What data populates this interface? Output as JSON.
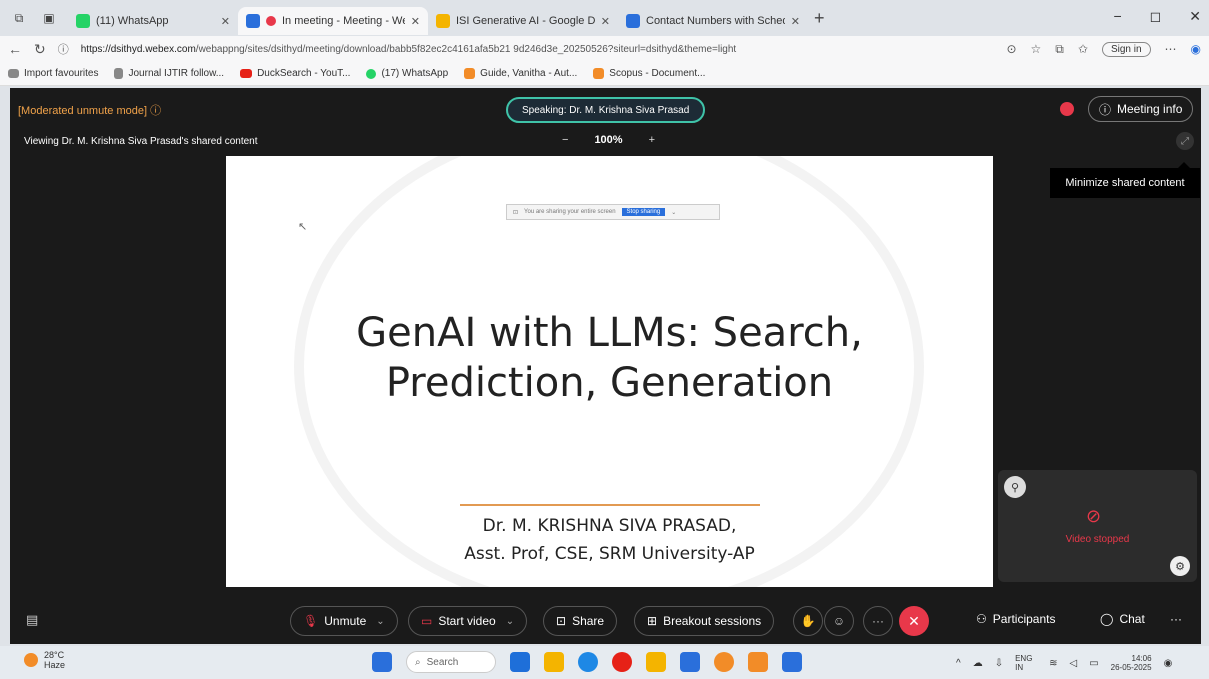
{
  "browser": {
    "tabs": [
      {
        "title": "(11) WhatsApp",
        "favicon_color": "#25d366",
        "active": false
      },
      {
        "title": "In meeting - Meeting - Web...",
        "favicon_color": "#2a6fdb",
        "active": true
      },
      {
        "title": "ISI Generative AI - Google Drive",
        "favicon_color": "#f4b400",
        "active": false
      },
      {
        "title": "Contact Numbers with Schedule...",
        "favicon_color": "#2a6fdb",
        "active": false
      }
    ],
    "url_host": "https://dsithyd.webex.com",
    "url_rest": "/webappng/sites/dsithyd/meeting/download/babb5f82ec2c4161afa5b21 9d246d3e_20250526?siteurl=dsithyd&theme=light",
    "signin_label": "Sign in",
    "favorites": [
      {
        "label": "Import favourites",
        "color": "#555555"
      },
      {
        "label": "Journal IJTIR follow...",
        "color": "#555555"
      },
      {
        "label": "DuckSearch - YouT...",
        "color": "#e62117"
      },
      {
        "label": "(17) WhatsApp",
        "color": "#25d366"
      },
      {
        "label": "Guide, Vanitha - Aut...",
        "color": "#f28c28"
      },
      {
        "label": "Scopus - Document...",
        "color": "#f28c28"
      }
    ]
  },
  "meeting": {
    "moderated_label": "[Moderated unmute mode]",
    "speaking_label": "Speaking: Dr. M. Krishna Siva Prasad",
    "meeting_info_label": "Meeting info",
    "viewing_label": "Viewing Dr. M. Krishna Siva Prasad's shared content",
    "zoom_minus": "−",
    "zoom_level": "100%",
    "zoom_plus": "+",
    "tooltip": "Minimize shared content",
    "self_view_status": "Video stopped"
  },
  "slide": {
    "sharebar_text": "You are sharing your entire screen",
    "sharebar_stop": "Stop sharing",
    "title_line1": "GenAI with LLMs: Search,",
    "title_line2": "Prediction, Generation",
    "author_line1": "Dr. M. KRISHNA SIVA PRASAD,",
    "author_line2": "Asst. Prof, CSE, SRM University-AP"
  },
  "controls": {
    "unmute": "Unmute",
    "start_video": "Start video",
    "share": "Share",
    "breakout": "Breakout sessions",
    "participants": "Participants",
    "chat": "Chat",
    "more": "···"
  },
  "taskbar": {
    "weather_temp": "28°C",
    "weather_desc": "Haze",
    "search_placeholder": "Search",
    "lang": "ENG IN",
    "time": "14:06",
    "date": "26-05-2025",
    "app_colors": [
      "#2a6fdb",
      "#1e6fd9",
      "#f4b400",
      "#e62117",
      "#25d366",
      "#f28c28",
      "#2a6fdb"
    ]
  }
}
